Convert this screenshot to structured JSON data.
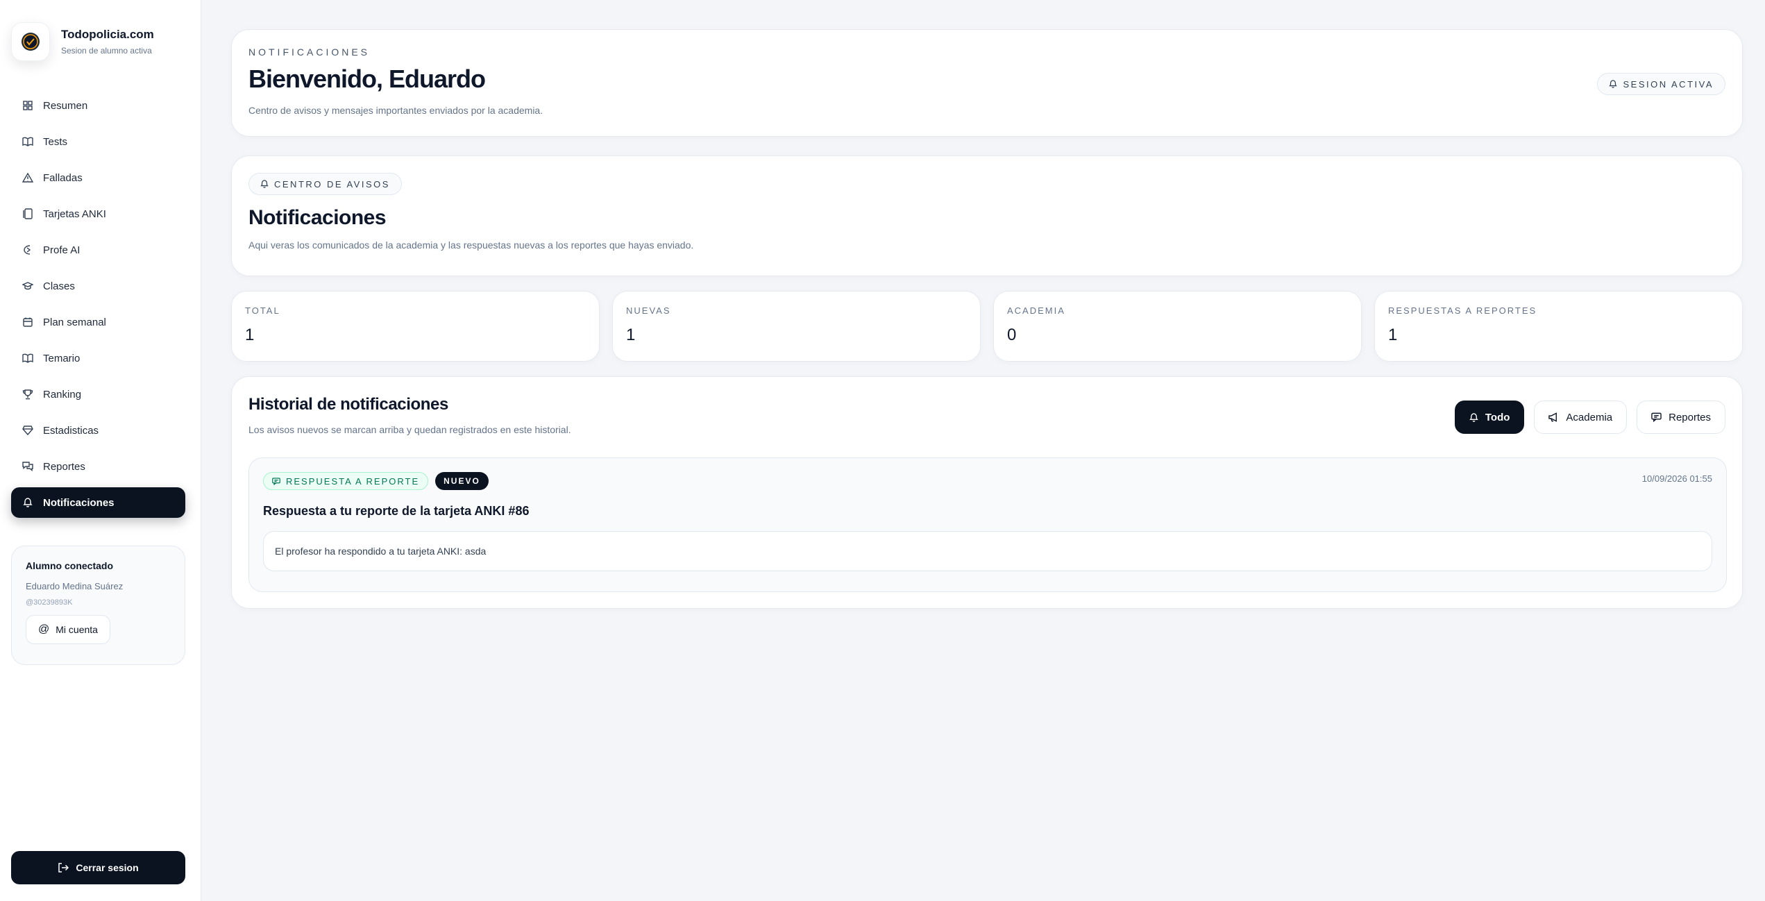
{
  "brand": {
    "title": "Todopolicia.com",
    "subtitle": "Sesion de alumno activa",
    "logo_icon": "police-badge-logo"
  },
  "sidebar": {
    "items": [
      {
        "label": "Resumen",
        "icon": "grid-icon"
      },
      {
        "label": "Tests",
        "icon": "book-icon"
      },
      {
        "label": "Falladas",
        "icon": "warning-icon"
      },
      {
        "label": "Tarjetas ANKI",
        "icon": "cards-icon"
      },
      {
        "label": "Profe AI",
        "icon": "ai-icon"
      },
      {
        "label": "Clases",
        "icon": "graduation-cap-icon"
      },
      {
        "label": "Plan semanal",
        "icon": "calendar-icon"
      },
      {
        "label": "Temario",
        "icon": "book-open-icon"
      },
      {
        "label": "Ranking",
        "icon": "trophy-icon"
      },
      {
        "label": "Estadisticas",
        "icon": "badge-icon"
      },
      {
        "label": "Reportes",
        "icon": "chat-icon"
      },
      {
        "label": "Notificaciones",
        "icon": "bell-icon",
        "active": true
      }
    ],
    "student": {
      "title": "Alumno conectado",
      "name": "Eduardo Medina Suárez",
      "id": "@30239893K",
      "account_label": "Mi cuenta"
    },
    "logout_label": "Cerrar sesion"
  },
  "welcome": {
    "eyebrow": "NOTIFICACIONES",
    "title": "Bienvenido, Eduardo",
    "description": "Centro de avisos y mensajes importantes enviados por la academia.",
    "session_pill": "SESION ACTIVA"
  },
  "avisos": {
    "pill": "CENTRO DE AVISOS",
    "title": "Notificaciones",
    "description": "Aqui veras los comunicados de la academia y las respuestas nuevas a los reportes que hayas enviado."
  },
  "stats": [
    {
      "label": "TOTAL",
      "value": "1"
    },
    {
      "label": "NUEVAS",
      "value": "1"
    },
    {
      "label": "ACADEMIA",
      "value": "0"
    },
    {
      "label": "RESPUESTAS A REPORTES",
      "value": "1"
    }
  ],
  "history": {
    "title": "Historial de notificaciones",
    "subtitle": "Los avisos nuevos se marcan arriba y quedan registrados en este historial.",
    "filters": [
      {
        "label": "Todo",
        "icon": "bell-icon",
        "active": true
      },
      {
        "label": "Academia",
        "icon": "megaphone-icon"
      },
      {
        "label": "Reportes",
        "icon": "chat-icon"
      }
    ],
    "notification": {
      "type_tag": "RESPUESTA A REPORTE",
      "status_tag": "NUEVO",
      "date": "10/09/2026 01:55",
      "title": "Respuesta a tu reporte de la tarjeta ANKI #86",
      "body": "El profesor ha respondido a tu tarjeta ANKI: asda"
    }
  },
  "colors": {
    "accent_dark": "#0b1220",
    "background": "#f3f5f8",
    "success": "#047857"
  }
}
